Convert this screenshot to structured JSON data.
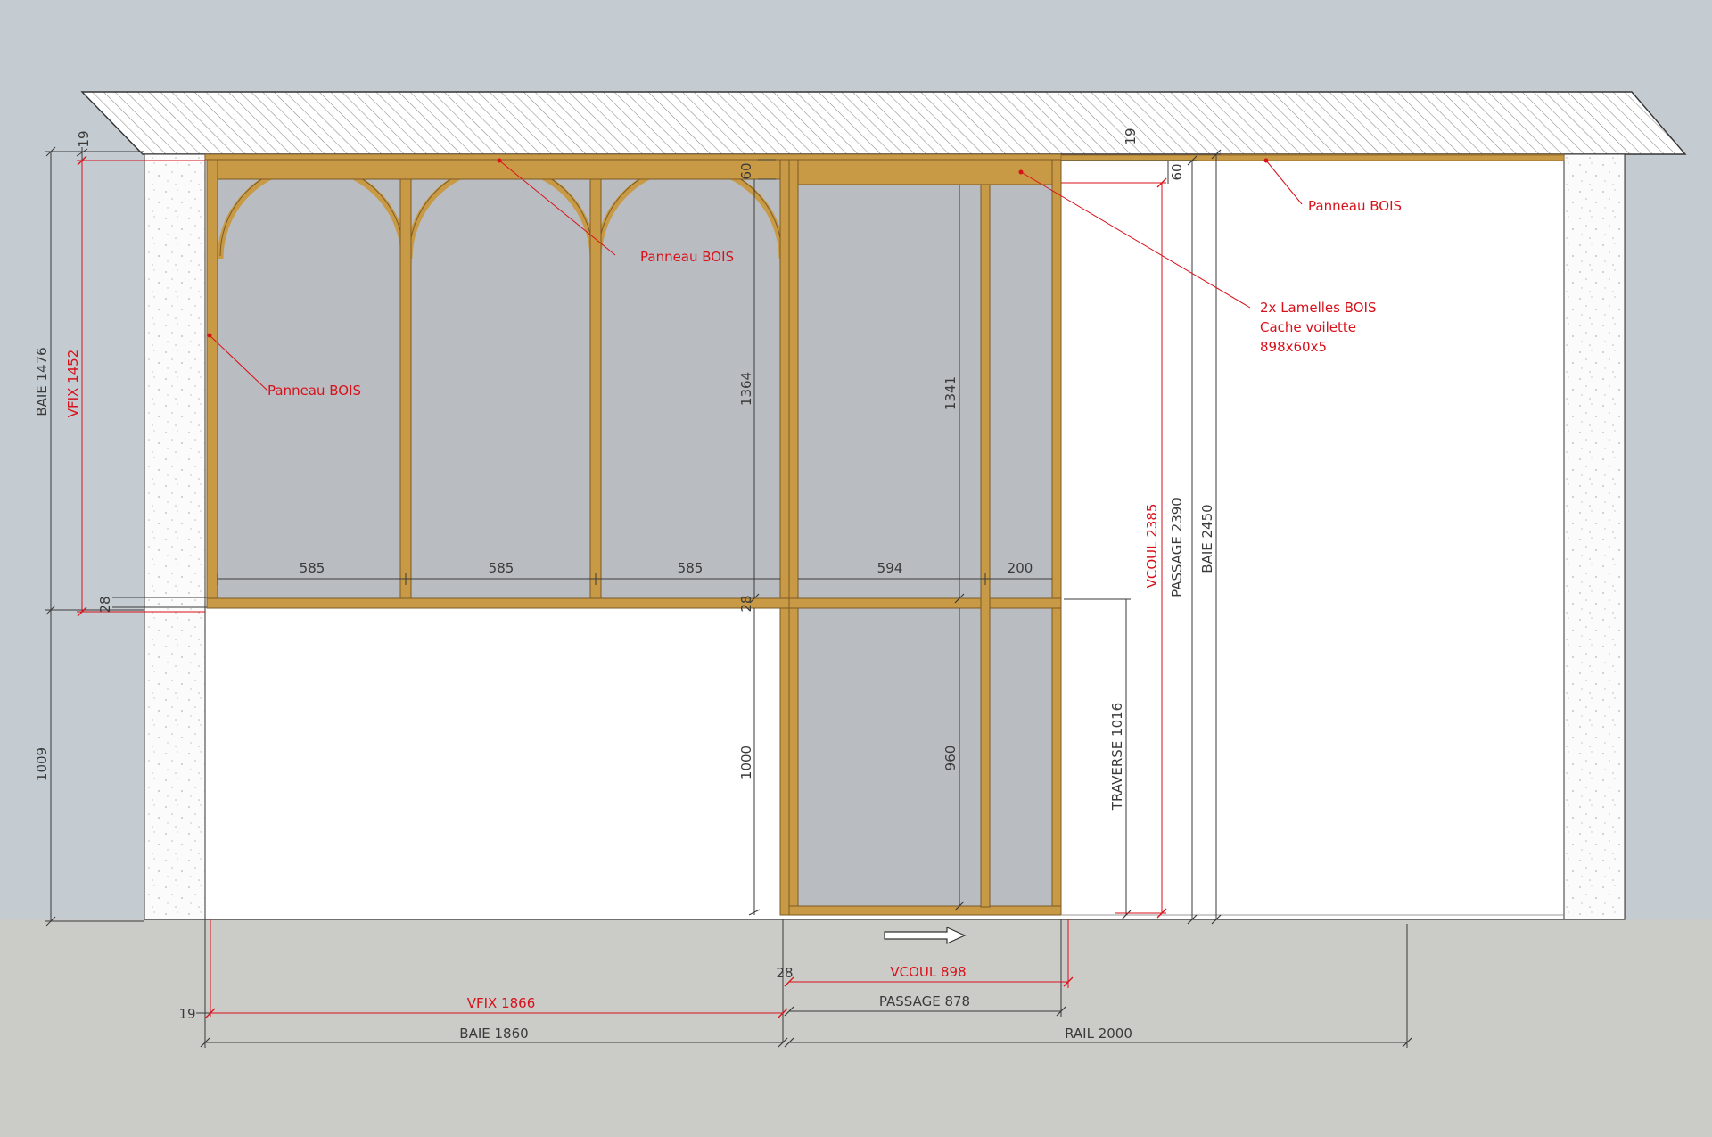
{
  "colors": {
    "background": "#c5ccd1",
    "floor": "#cbcbc8",
    "wall": "#ffffff",
    "wood": "#c99a45",
    "wood_dark": "#7a5a26",
    "glass": "#b9bdc1",
    "annotation_red": "#d8111a",
    "dimension": "#3a3a3a"
  },
  "annotations": {
    "panneau_bois_top": "Panneau BOIS",
    "panneau_bois_arch": "Panneau BOIS",
    "panneau_bois_left": "Panneau BOIS",
    "lamelles_line1": "2x Lamelles BOIS",
    "lamelles_line2": "Cache voilette",
    "lamelles_line3": "898x60x5"
  },
  "dimensions": {
    "top_left_19": "19",
    "top_right_19": "19",
    "baie_1476": "BAIE 1476",
    "vfix_1452": "VFIX 1452",
    "d_28_left": "28",
    "h_1009": "1009",
    "h_60_a": "60",
    "h_60_b": "60",
    "h_1364": "1364",
    "h_1341": "1341",
    "w_585_1": "585",
    "w_585_2": "585",
    "w_585_3": "585",
    "w_594": "594",
    "w_200": "200",
    "d_28_mid": "28",
    "h_1000": "1000",
    "h_960": "960",
    "traverse_1016": "TRAVERSE 1016",
    "vcoul_2385": "VCOUL 2385",
    "passage_2390": "PASSAGE 2390",
    "baie_2450": "BAIE 2450",
    "d_28_bottom": "28",
    "vcoul_898": "VCOUL 898",
    "passage_878": "PASSAGE 878",
    "d_19_bottom": "19",
    "vfix_1866": "VFIX 1866",
    "baie_1860": "BAIE 1860",
    "rail_2000": "RAIL 2000"
  },
  "icons": {
    "direction": "slide-direction-arrow-icon"
  }
}
